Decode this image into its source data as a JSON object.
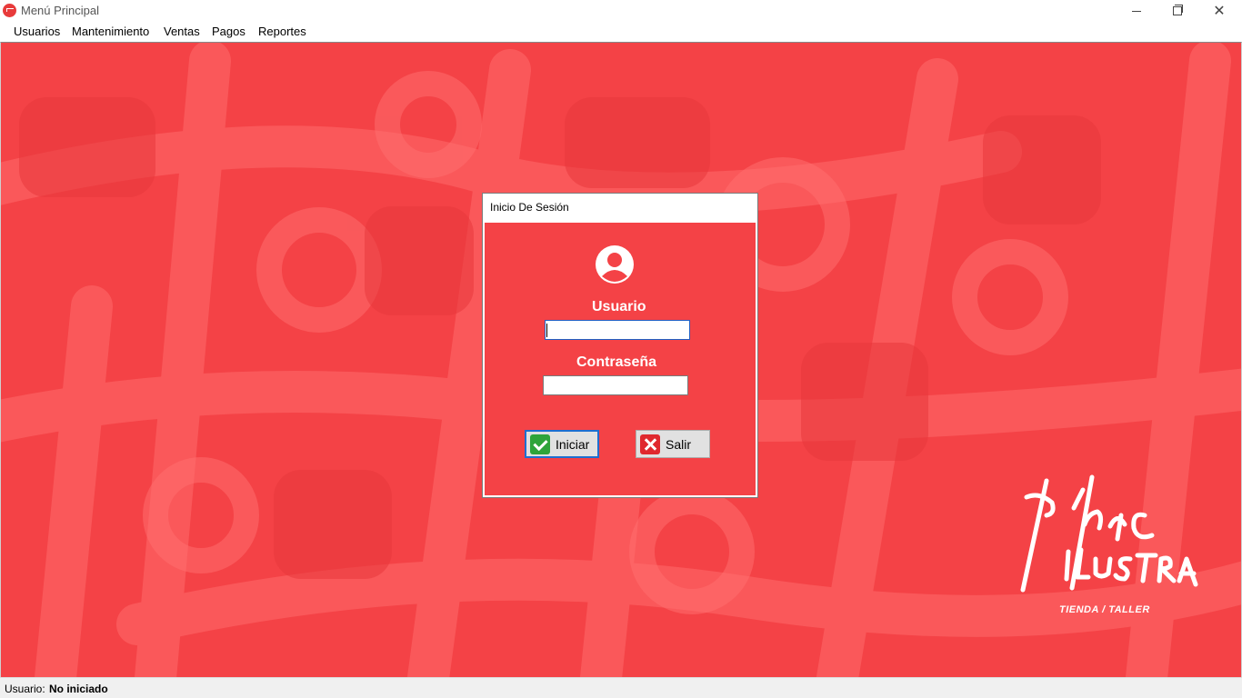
{
  "window": {
    "title": "Menú Principal",
    "icon": "app-logo-icon",
    "controls": [
      "minimize-icon",
      "maximize-icon",
      "close-icon"
    ]
  },
  "menu": {
    "items": [
      "Usuarios",
      "Mantenimiento",
      "Ventas",
      "Pagos",
      "Reportes"
    ]
  },
  "background": {
    "color": "#f44246",
    "pattern_color": "#ff6b6b"
  },
  "brand": {
    "name": "Marc Ilustra",
    "tagline": "TIENDA / TALLER"
  },
  "login_dialog": {
    "title": "Inicio De Sesión",
    "user_label": "Usuario",
    "user_value": "",
    "password_label": "Contraseña",
    "password_value": "",
    "login_button": "Iniciar",
    "exit_button": "Salir"
  },
  "status": {
    "label": "Usuario:",
    "value": "No iniciado"
  }
}
